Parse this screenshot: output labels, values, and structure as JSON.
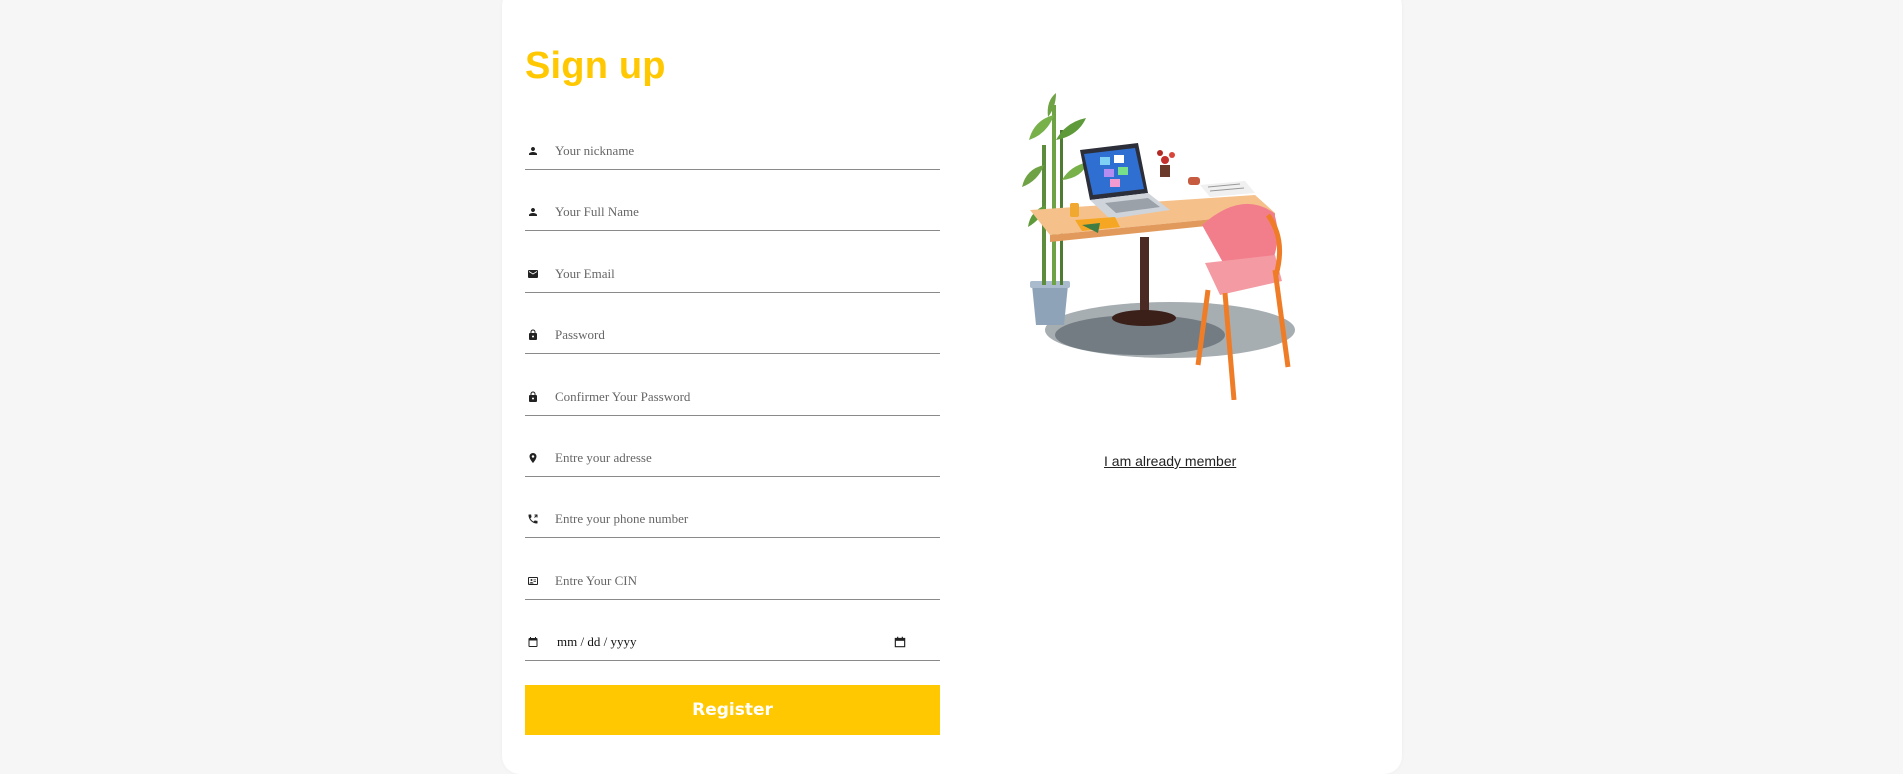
{
  "header": {
    "title": "Sign up"
  },
  "form": {
    "fields": [
      {
        "icon": "person-icon",
        "placeholder": "Your nickname",
        "value": ""
      },
      {
        "icon": "person-icon",
        "placeholder": "Your Full Name",
        "value": ""
      },
      {
        "icon": "email-icon",
        "placeholder": "Your Email",
        "value": ""
      },
      {
        "icon": "lock-icon",
        "placeholder": "Password",
        "value": ""
      },
      {
        "icon": "lock-icon",
        "placeholder": "Confirmer Your Password",
        "value": ""
      },
      {
        "icon": "location-pin-icon",
        "placeholder": "Entre your adresse",
        "value": ""
      },
      {
        "icon": "phone-icon",
        "placeholder": "Entre your phone number",
        "value": ""
      },
      {
        "icon": "id-card-icon",
        "placeholder": "Entre Your CIN",
        "value": ""
      }
    ],
    "date": {
      "icon": "calendar-icon",
      "display": "mm / dd / yyyy",
      "picker_icon": "calendar-picker-icon"
    },
    "register_label": "Register"
  },
  "aside": {
    "illustration": "desk-with-laptop-chair-and-plant-illustration",
    "login_link": "I am already member"
  },
  "colors": {
    "accent": "#ffc800",
    "background": "#f6f6f6",
    "card": "#ffffff"
  }
}
